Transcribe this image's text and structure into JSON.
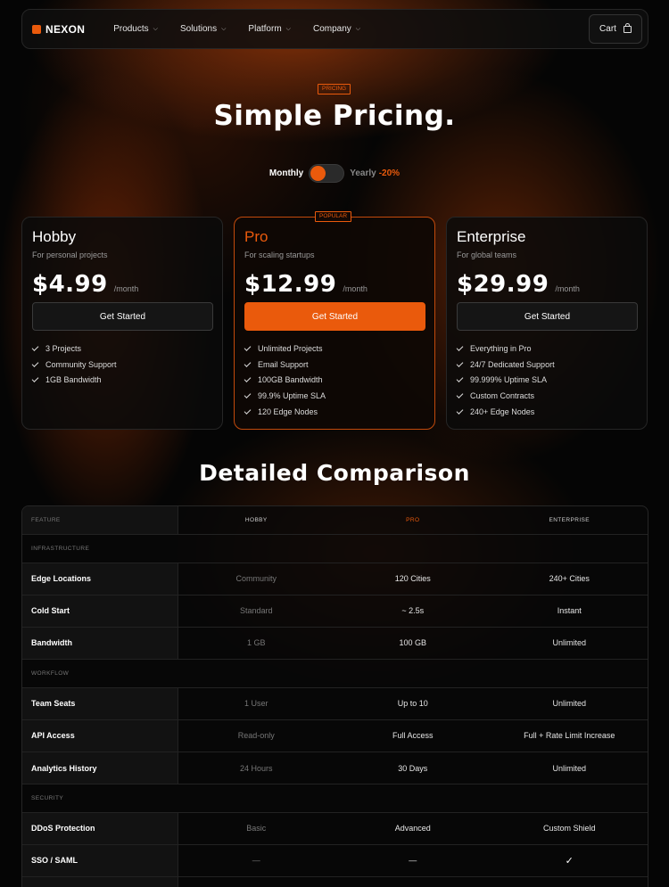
{
  "nav": {
    "brand": "NEXON",
    "links": [
      {
        "label": "Products"
      },
      {
        "label": "Solutions"
      },
      {
        "label": "Platform"
      },
      {
        "label": "Company"
      }
    ],
    "cart_label": "Cart"
  },
  "hero": {
    "tag": "PRICING",
    "title": "Simple Pricing.",
    "toggle": {
      "left": "Monthly",
      "right": "Yearly",
      "discount": "-20%",
      "state": "monthly"
    }
  },
  "plans": [
    {
      "name": "Hobby",
      "subtitle": "For personal projects",
      "price": "$4.99",
      "period": "/month",
      "cta": "Get Started",
      "features": [
        "3 Projects",
        "Community Support",
        "1GB Bandwidth"
      ]
    },
    {
      "name": "Pro",
      "badge": "POPULAR",
      "subtitle": "For scaling startups",
      "price": "$12.99",
      "period": "/month",
      "cta": "Get Started",
      "features": [
        "Unlimited Projects",
        "Email Support",
        "100GB Bandwidth",
        "99.9% Uptime SLA",
        "120 Edge Nodes"
      ]
    },
    {
      "name": "Enterprise",
      "subtitle": "For global teams",
      "price": "$29.99",
      "period": "/month",
      "cta": "Get Started",
      "features": [
        "Everything in Pro",
        "24/7 Dedicated Support",
        "99.999% Uptime SLA",
        "Custom Contracts",
        "240+ Edge Nodes"
      ]
    }
  ],
  "comparison": {
    "title": "Detailed Comparison",
    "headers": [
      "FEATURE",
      "HOBBY",
      "PRO",
      "ENTERPRISE"
    ],
    "sections": [
      {
        "label": "INFRASTRUCTURE",
        "rows": [
          [
            "Edge Locations",
            "Community",
            "120 Cities",
            "240+ Cities"
          ],
          [
            "Cold Start",
            "Standard",
            "~ 2.5s",
            "Instant"
          ],
          [
            "Bandwidth",
            "1 GB",
            "100 GB",
            "Unlimited"
          ]
        ]
      },
      {
        "label": "WORKFLOW",
        "rows": [
          [
            "Team Seats",
            "1 User",
            "Up to 10",
            "Unlimited"
          ],
          [
            "API Access",
            "Read-only",
            "Full Access",
            "Full + Rate Limit Increase"
          ],
          [
            "Analytics History",
            "24 Hours",
            "30 Days",
            "Unlimited"
          ]
        ]
      },
      {
        "label": "SECURITY",
        "rows": [
          [
            "DDoS Protection",
            "Basic",
            "Advanced",
            "Custom Shield"
          ],
          [
            "SSO / SAML",
            "—",
            "—",
            "✓"
          ]
        ]
      }
    ]
  },
  "colors": {
    "accent": "#ea5a0c",
    "background": "#050505"
  }
}
